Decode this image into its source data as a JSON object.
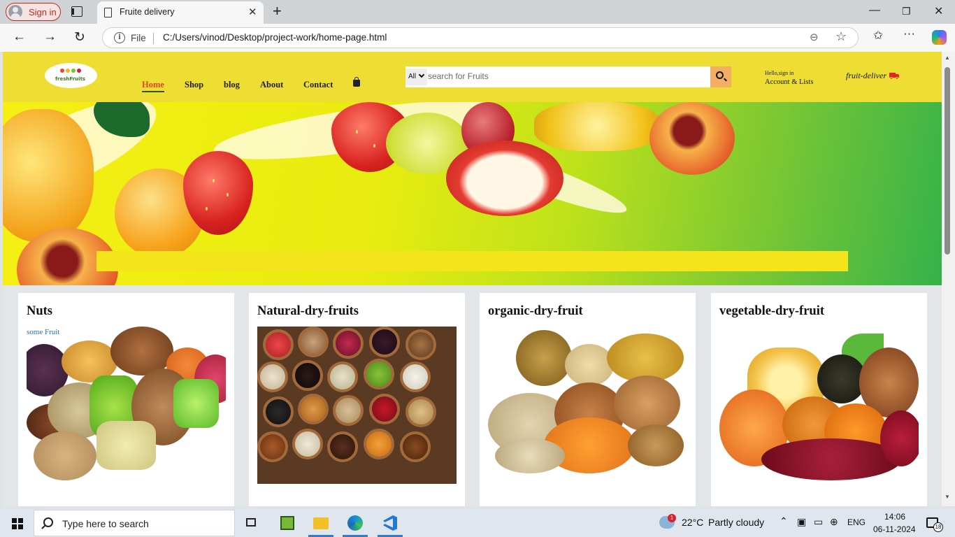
{
  "browser": {
    "signin_label": "Sign in",
    "tab_title": "Fruite delivery",
    "file_label": "File",
    "url": "C:/Users/vinod/Desktop/project-work/home-page.html"
  },
  "site": {
    "nav": [
      "Home",
      "Shop",
      "blog",
      "About",
      "Contact"
    ],
    "active_nav": "Home",
    "search": {
      "category": "All",
      "placeholder": "search for Fruits"
    },
    "account": {
      "hello": "Hello,sign in",
      "lists": "Account & Lists"
    },
    "deliver_label": "fruit-deliver",
    "logo_text": "freshFruits"
  },
  "cards": [
    {
      "title": "Nuts",
      "caption": "some Fruit"
    },
    {
      "title": "Natural-dry-fruits"
    },
    {
      "title": "organic-dry-fruit"
    },
    {
      "title": "vegetable-dry-fruit"
    }
  ],
  "taskbar": {
    "search_placeholder": "Type here to search",
    "weather_temp": "22°C",
    "weather_text": "Partly cloudy",
    "language": "ENG",
    "time": "14:06",
    "date": "06-11-2024",
    "notification_count": "18",
    "weather_badge": "1"
  },
  "colors": {
    "header_bg": "#eede33",
    "search_button": "#f2ae62",
    "active_nav": "#e0452b",
    "caption": "#1a6ee0"
  }
}
